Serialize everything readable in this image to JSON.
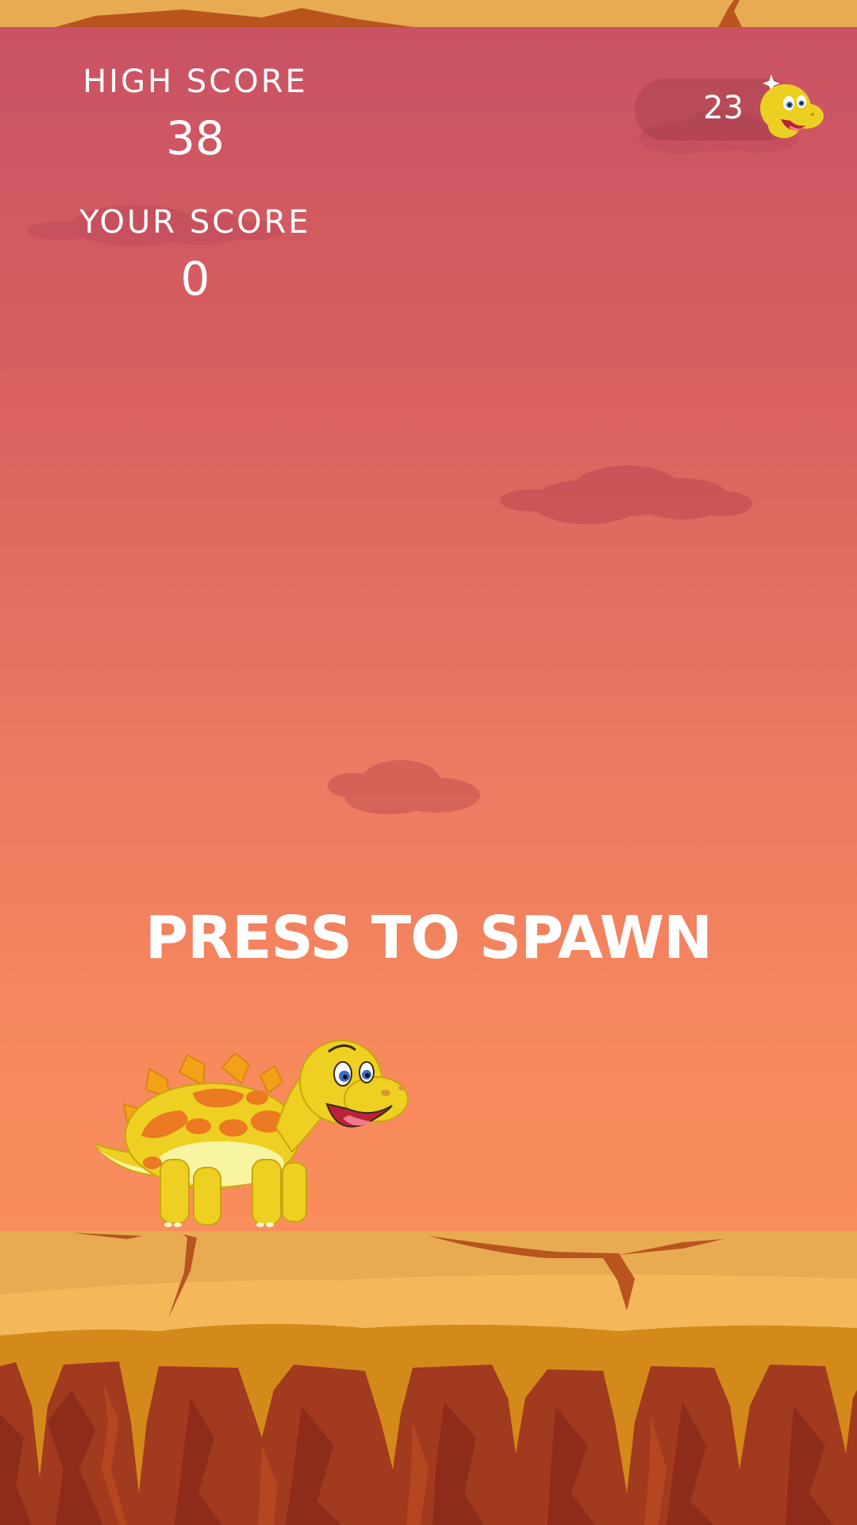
{
  "hud": {
    "high_score_label": "HIGH SCORE",
    "high_score_value": "38",
    "your_score_label": "YOUR SCORE",
    "your_score_value": "0",
    "coin_count": "23",
    "coin_icon": "dino-head-icon"
  },
  "prompt": {
    "text": "PRESS TO SPAWN"
  },
  "scene": {
    "character": "stegosaurus-dino",
    "colors": {
      "sky_top": "#c95264",
      "sky_bottom": "#fa8d5c",
      "ground": "#e8ab52",
      "lava": "#d48a1a",
      "rock": "#a13a1e",
      "text": "#ffffff"
    }
  }
}
